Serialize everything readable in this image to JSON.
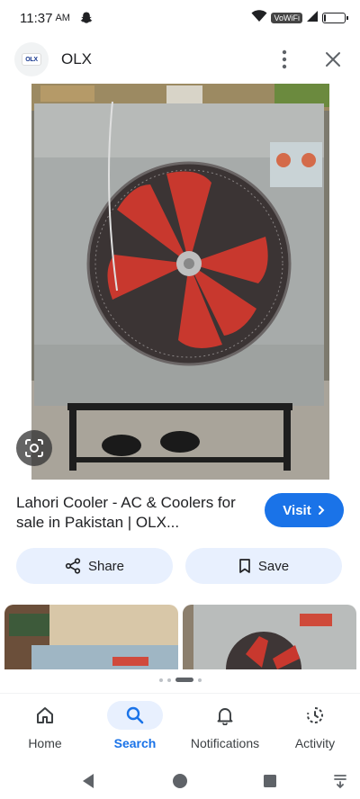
{
  "status_bar": {
    "time": "11:37",
    "ampm": "AM",
    "network_label": "VoWiFi",
    "battery_level": 0.1
  },
  "header": {
    "logo_text": "OLX",
    "site_name": "OLX",
    "icons": [
      "more-vert-icon",
      "close-icon"
    ]
  },
  "main_image": {
    "subject": "Lahori air cooler with red fan on metal stand"
  },
  "result": {
    "title": "Lahori Cooler - AC & Coolers for sale in Pakistan | OLX...",
    "visit_label": "Visit",
    "share_label": "Share",
    "save_label": "Save"
  },
  "pagination": {
    "dot_count": 4,
    "active_index": 2
  },
  "bottom_nav": {
    "items": [
      {
        "label": "Home",
        "icon": "home-icon",
        "active": false
      },
      {
        "label": "Search",
        "icon": "search-icon",
        "active": true
      },
      {
        "label": "Notifications",
        "icon": "bell-icon",
        "active": false
      },
      {
        "label": "Activity",
        "icon": "activity-icon",
        "active": false
      }
    ]
  },
  "colors": {
    "accent": "#1a73e8",
    "pill_bg": "#e8f0fe",
    "fan_red": "#c8382e"
  }
}
